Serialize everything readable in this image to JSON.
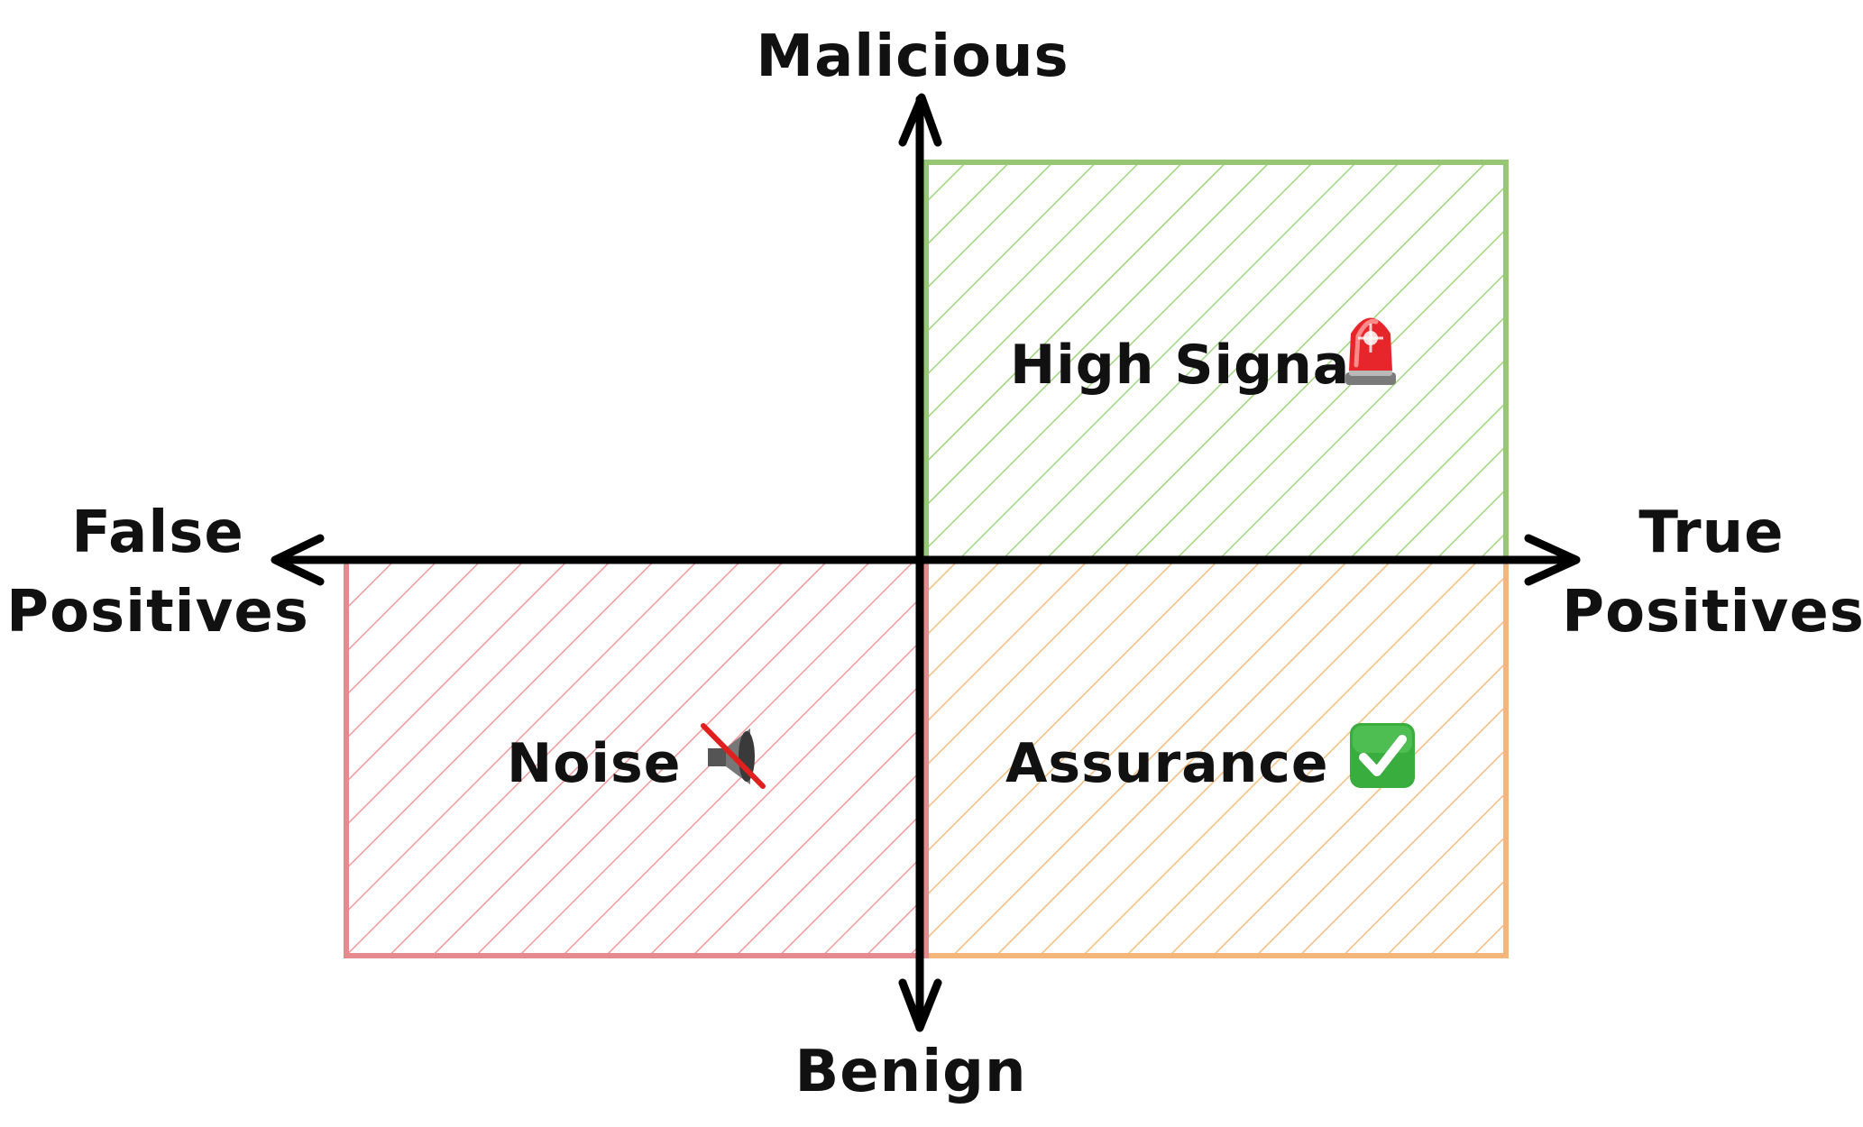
{
  "axes": {
    "top": "Malicious",
    "bottom": "Benign",
    "left_line1": "False",
    "left_line2": "Positives",
    "right_line1": "True",
    "right_line2": "Positives",
    "color": "#000000"
  },
  "quadrants": {
    "high_signal": {
      "label": "High Signal",
      "icon": "police-siren-icon",
      "color": "#8fcf6a"
    },
    "assurance": {
      "label": "Assurance",
      "icon": "check-mark-button-icon",
      "color": "#f2a85a"
    },
    "noise": {
      "label": "Noise",
      "icon": "muted-speaker-icon",
      "color": "#e8767a"
    }
  }
}
